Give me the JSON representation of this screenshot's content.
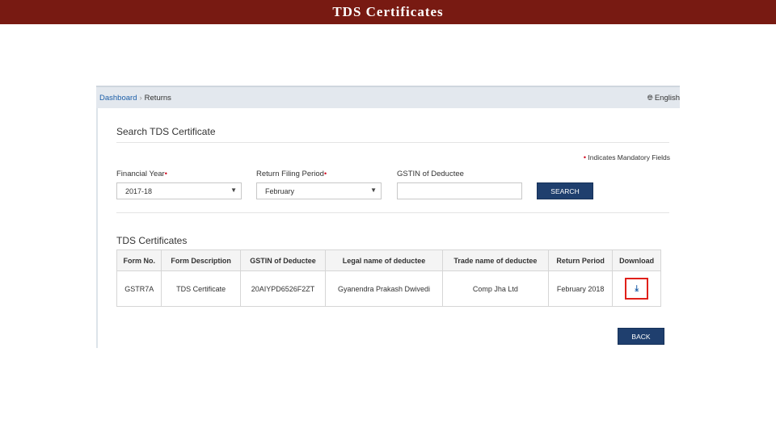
{
  "slide": {
    "title": "TDS Certificates"
  },
  "breadcrumb": {
    "dashboard": "Dashboard",
    "separator": "›",
    "current": "Returns"
  },
  "language": {
    "icon": "globe-icon",
    "label": "English"
  },
  "search": {
    "title": "Search TDS Certificate",
    "mandatory_dot": "•",
    "mandatory_note": "Indicates Mandatory Fields",
    "financial_year": {
      "label": "Financial Year",
      "value": "2017-18"
    },
    "return_period": {
      "label": "Return Filing Period",
      "value": "February"
    },
    "gstin": {
      "label": "GSTIN of Deductee",
      "value": ""
    },
    "button": "SEARCH"
  },
  "certificates": {
    "title": "TDS Certificates",
    "columns": [
      "Form No.",
      "Form Description",
      "GSTIN of Deductee",
      "Legal name of deductee",
      "Trade name of deductee",
      "Return Period",
      "Download"
    ],
    "rows": [
      {
        "form_no": "GSTR7A",
        "description": "TDS Certificate",
        "gstin": "20AIYPD6526F2ZT",
        "legal_name": "Gyanendra Prakash Dwivedi",
        "trade_name": "Comp Jha Ltd",
        "return_period": "February 2018",
        "download_icon": "download-icon"
      }
    ]
  },
  "back_button": "BACK",
  "colors": {
    "header_bg": "#781a12",
    "button_bg": "#1f3f6e",
    "highlight": "#e0201a",
    "link": "#1d5fa8"
  }
}
